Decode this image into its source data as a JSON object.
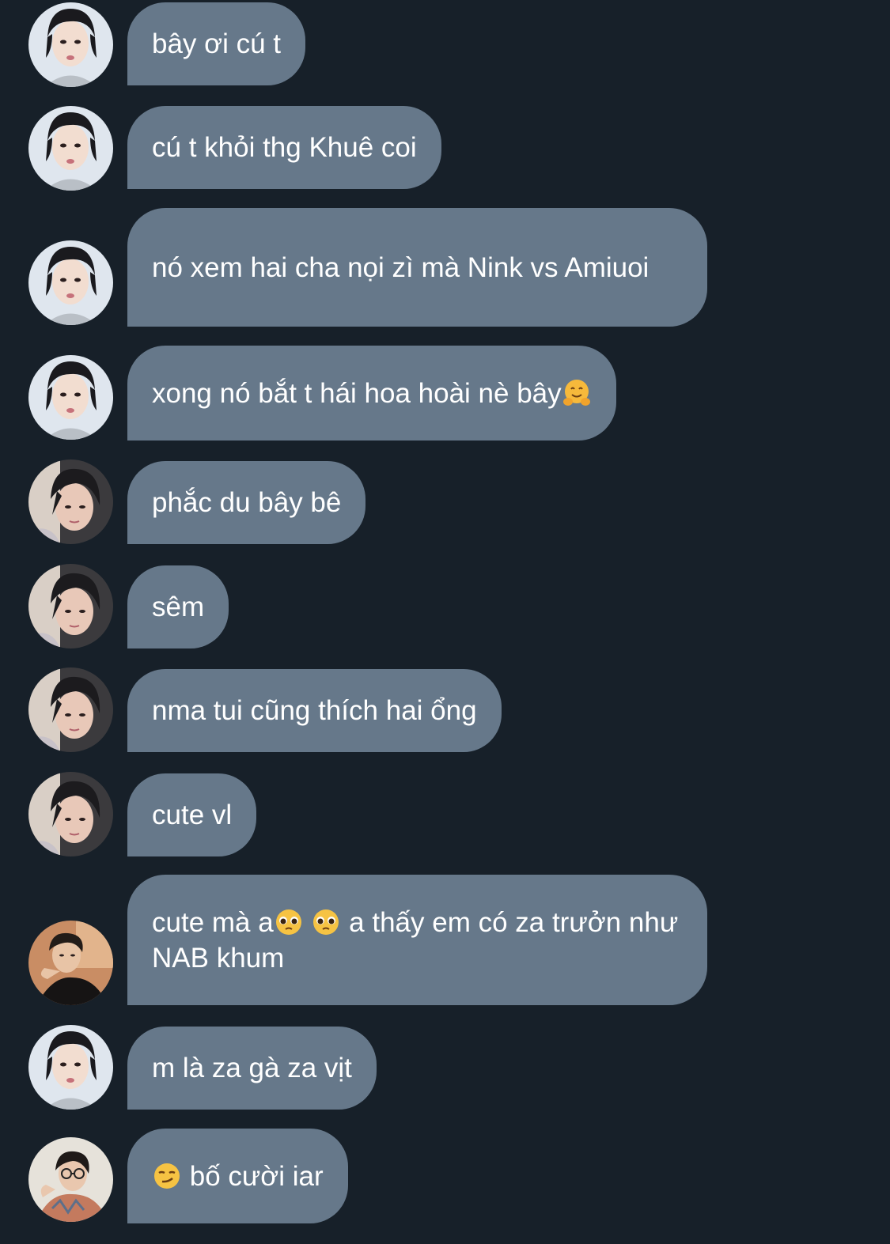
{
  "colors": {
    "background": "#172029",
    "bubble": "#66788a",
    "text": "#ffffff"
  },
  "messages": [
    {
      "avatar": "avatar-a",
      "text": "bây ơi cú t"
    },
    {
      "avatar": "avatar-a",
      "text": "cú t khỏi thg Khuê coi"
    },
    {
      "avatar": "avatar-a",
      "text": "nó xem hai cha nọi zì mà Nink vs Amiuoi"
    },
    {
      "avatar": "avatar-a",
      "text": "xong nó bắt t hái hoa hoài nè bây",
      "emoji_after": "hugging-face-emoji"
    },
    {
      "avatar": "avatar-b",
      "text": "phắc du bây bê"
    },
    {
      "avatar": "avatar-b",
      "text": "sêm"
    },
    {
      "avatar": "avatar-b",
      "text": "nma tui cũng thích hai ổng"
    },
    {
      "avatar": "avatar-b",
      "text": "cute vl"
    },
    {
      "avatar": "avatar-c",
      "text_part1": "cute mà a",
      "emoji_mid": "pleading-face-emoji",
      "text_part2": " a thấy em có za trưởn như NAB khum"
    },
    {
      "avatar": "avatar-a",
      "text": "m là za gà za vịt"
    },
    {
      "avatar": "avatar-d",
      "emoji_before": "smirking-face-emoji",
      "text": " bố cười iar"
    }
  ]
}
